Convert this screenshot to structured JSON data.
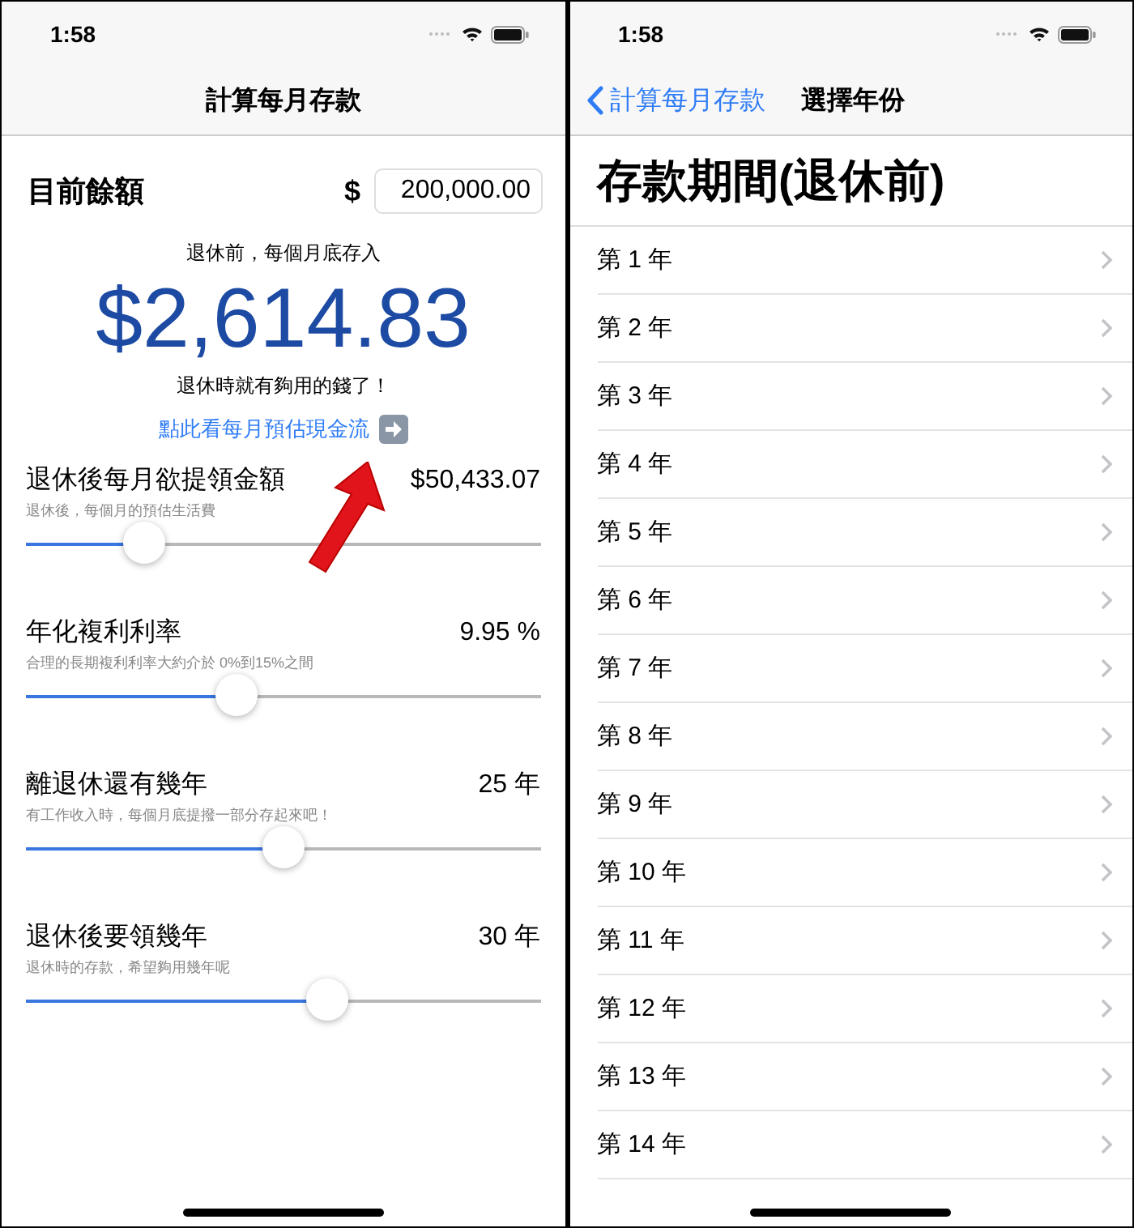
{
  "screens": [
    {
      "status_bar": {
        "time": "1:58"
      },
      "nav": {
        "title": "計算每月存款"
      },
      "balance": {
        "label": "目前餘額",
        "currency": "$",
        "value": "200,000.00"
      },
      "result": {
        "caption": "退休前，每個月底存入",
        "amount": "$2,614.83",
        "note": "退休時就有夠用的錢了！",
        "link": "點此看每月預估現金流"
      },
      "sliders": [
        {
          "title": "退休後每月欲提領金額",
          "value": "$50,433.07",
          "hint": "退休後，每個月的預估生活費",
          "level": 0.23
        },
        {
          "title": "年化複利利率",
          "value": "9.95 %",
          "hint": "合理的長期複利利率大約介於 0%到15%之間",
          "level": 0.41
        },
        {
          "title": "離退休還有幾年",
          "value": "25 年",
          "hint": "有工作收入時，每個月底提撥一部分存起來吧！",
          "level": 0.5
        },
        {
          "title": "退休後要領幾年",
          "value": "30 年",
          "hint": "退休時的存款，希望夠用幾年呢",
          "level": 0.585
        }
      ]
    },
    {
      "status_bar": {
        "time": "1:58"
      },
      "nav": {
        "back": "計算每月存款",
        "title": "選擇年份"
      },
      "heading": "存款期間(退休前)",
      "years": [
        "第 1 年",
        "第 2 年",
        "第 3 年",
        "第 4 年",
        "第 5 年",
        "第 6 年",
        "第 7 年",
        "第 8 年",
        "第 9 年",
        "第 10 年",
        "第 11 年",
        "第 12 年",
        "第 13 年",
        "第 14 年"
      ]
    }
  ]
}
